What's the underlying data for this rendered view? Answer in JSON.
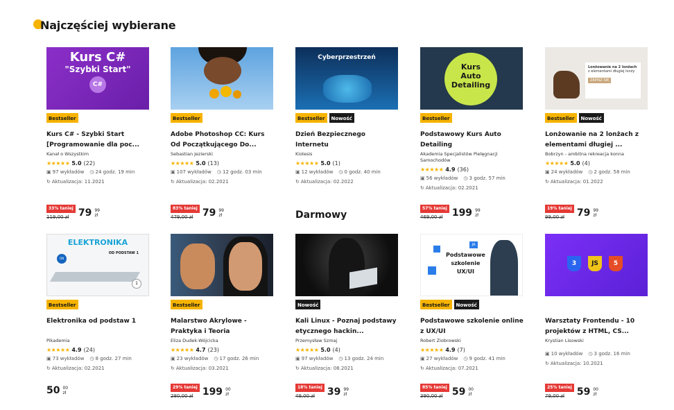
{
  "section_title": "Najczęściej wybierane",
  "free_section_title": "Darmowy",
  "colors": {
    "accent": "#f6b300",
    "discount": "#e53935",
    "new_badge": "#1a1a1a"
  },
  "courses": [
    {
      "thumb_text": [
        "Kurs C#",
        "\"Szybki Start\"",
        "C#"
      ],
      "badges": [
        "Bestseller"
      ],
      "title": "Kurs C# - Szybki Start [Programowanie dla poc...",
      "author": "Kanał o Wszystkim",
      "rating": "5.0",
      "rating_count": "(22)",
      "stars": "★★★★★",
      "lectures": "97 wykładów",
      "duration": "24 godz. 19 min",
      "updated": "Aktualizacja: 11.2021",
      "discount": "33% taniej",
      "old_price": "119,00 zł",
      "price": "79",
      "price_cents": "99",
      "currency": "zł"
    },
    {
      "thumb_text": [],
      "badges": [
        "Bestseller"
      ],
      "title": "Adobe Photoshop CC: Kurs Od Początkującego Do...",
      "author": "Sebastian Jezierski",
      "rating": "5.0",
      "rating_count": "(13)",
      "stars": "★★★★★",
      "lectures": "107 wykładów",
      "duration": "12 godz. 03 min",
      "updated": "Aktualizacja: 02.2021",
      "discount": "83% taniej",
      "old_price": "479,00 zł",
      "price": "79",
      "price_cents": "99",
      "currency": "zł"
    },
    {
      "thumb_text": [
        "Cyberprzestrzeń"
      ],
      "badges": [
        "Bestseller",
        "Nowość"
      ],
      "title": "Dzień Bezpiecznego Internetu",
      "author": "Kiolesis",
      "rating": "5.0",
      "rating_count": "(1)",
      "stars": "★★★★★",
      "lectures": "12 wykładów",
      "duration": "0 godz. 40 min",
      "updated": "Aktualizacja: 02.2022"
    },
    {
      "thumb_text": [
        "Kurs",
        "Auto",
        "Detailing"
      ],
      "badges": [
        "Bestseller"
      ],
      "title": "Podstawowy Kurs Auto Detailing",
      "author": "Akademia Specjalistów Pielęgnacji Samochodów",
      "rating": "4.9",
      "rating_count": "(36)",
      "stars": "★★★★★",
      "lectures": "56 wykładów",
      "duration": "3 godz. 57 min",
      "updated": "Aktualizacja: 02.2021",
      "discount": "57% taniej",
      "old_price": "469,00 zł",
      "price": "199",
      "price_cents": "99",
      "currency": "zł"
    },
    {
      "thumb_text": [
        "Lonżowanie na 2 lonżach",
        "z elementami długiej lonży",
        "ZAPISZ SIĘ"
      ],
      "badges": [
        "Bestseller",
        "Nowość"
      ],
      "title": "Lonżowanie na 2 lonżach z elementami długiej ...",
      "author": "Bobrzyn - ambitna rekreacja konna",
      "rating": "5.0",
      "rating_count": "(4)",
      "stars": "★★★★★",
      "lectures": "24 wykładów",
      "duration": "2 godz. 58 min",
      "updated": "Aktualizacja: 01.2022",
      "discount": "19% taniej",
      "old_price": "99,00 zł",
      "price": "79",
      "price_cents": "99",
      "currency": "zł"
    },
    {
      "thumb_text": [
        "ELEKTRONIKA",
        "OD PODSTAW 1",
        "ON",
        "1"
      ],
      "badges": [
        "Bestseller"
      ],
      "title": "Elektronika od podstaw 1",
      "author": "Pikademia",
      "rating": "4.9",
      "rating_count": "(24)",
      "stars": "★★★★★",
      "lectures": "73 wykładów",
      "duration": "8 godz. 27 min",
      "updated": "Aktualizacja: 02.2021",
      "price": "50",
      "price_cents": "00",
      "currency": "zł"
    },
    {
      "thumb_text": [],
      "badges": [
        "Bestseller"
      ],
      "title": "Malarstwo Akrylowe - Praktyka i Teoria",
      "author": "Eliza Dudek-Wójcicka",
      "rating": "4.7",
      "rating_count": "(23)",
      "stars": "★★★★★",
      "lectures": "23 wykładów",
      "duration": "17 godz. 26 min",
      "updated": "Aktualizacja: 03.2021",
      "discount": "29% taniej",
      "old_price": "280,00 zł",
      "price": "199",
      "price_cents": "00",
      "currency": "zł"
    },
    {
      "thumb_text": [],
      "badges": [
        "Nowość"
      ],
      "title": "Kali Linux - Poznaj podstawy etycznego hackin...",
      "author": "Przemysław Szmaj",
      "rating": "5.0",
      "rating_count": "(4)",
      "stars": "★★★★★",
      "lectures": "97 wykładów",
      "duration": "13 godz. 24 min",
      "updated": "Aktualizacja: 08.2021",
      "discount": "18% taniej",
      "old_price": "49,00 zł",
      "price": "39",
      "price_cents": "99",
      "currency": "zł"
    },
    {
      "thumb_text": [
        "Podstawowe",
        "szkolenie",
        "UX/UI",
        "JA"
      ],
      "badges": [
        "Bestseller",
        "Nowość"
      ],
      "title": "Podstawowe szkolenie online z UX/UI",
      "author": "Robert Ziobrowski",
      "rating": "4.9",
      "rating_count": "(7)",
      "stars": "★★★★★",
      "lectures": "27 wykładów",
      "duration": "9 godz. 41 min",
      "updated": "Aktualizacja: 07.2021",
      "discount": "85% taniej",
      "old_price": "390,00 zł",
      "price": "59",
      "price_cents": "00",
      "currency": "zł"
    },
    {
      "thumb_text": [
        "3",
        "JS",
        "5"
      ],
      "badges": [],
      "title": "Warsztaty Frontendu - 10 projektów z HTML, CS...",
      "author": "Krystian Lisowski",
      "lectures": "10 wykładów",
      "duration": "3 godz. 16 min",
      "updated": "Aktualizacja: 10.2021",
      "discount": "25% taniej",
      "old_price": "79,00 zł",
      "price": "59",
      "price_cents": "00",
      "currency": "zł"
    }
  ]
}
